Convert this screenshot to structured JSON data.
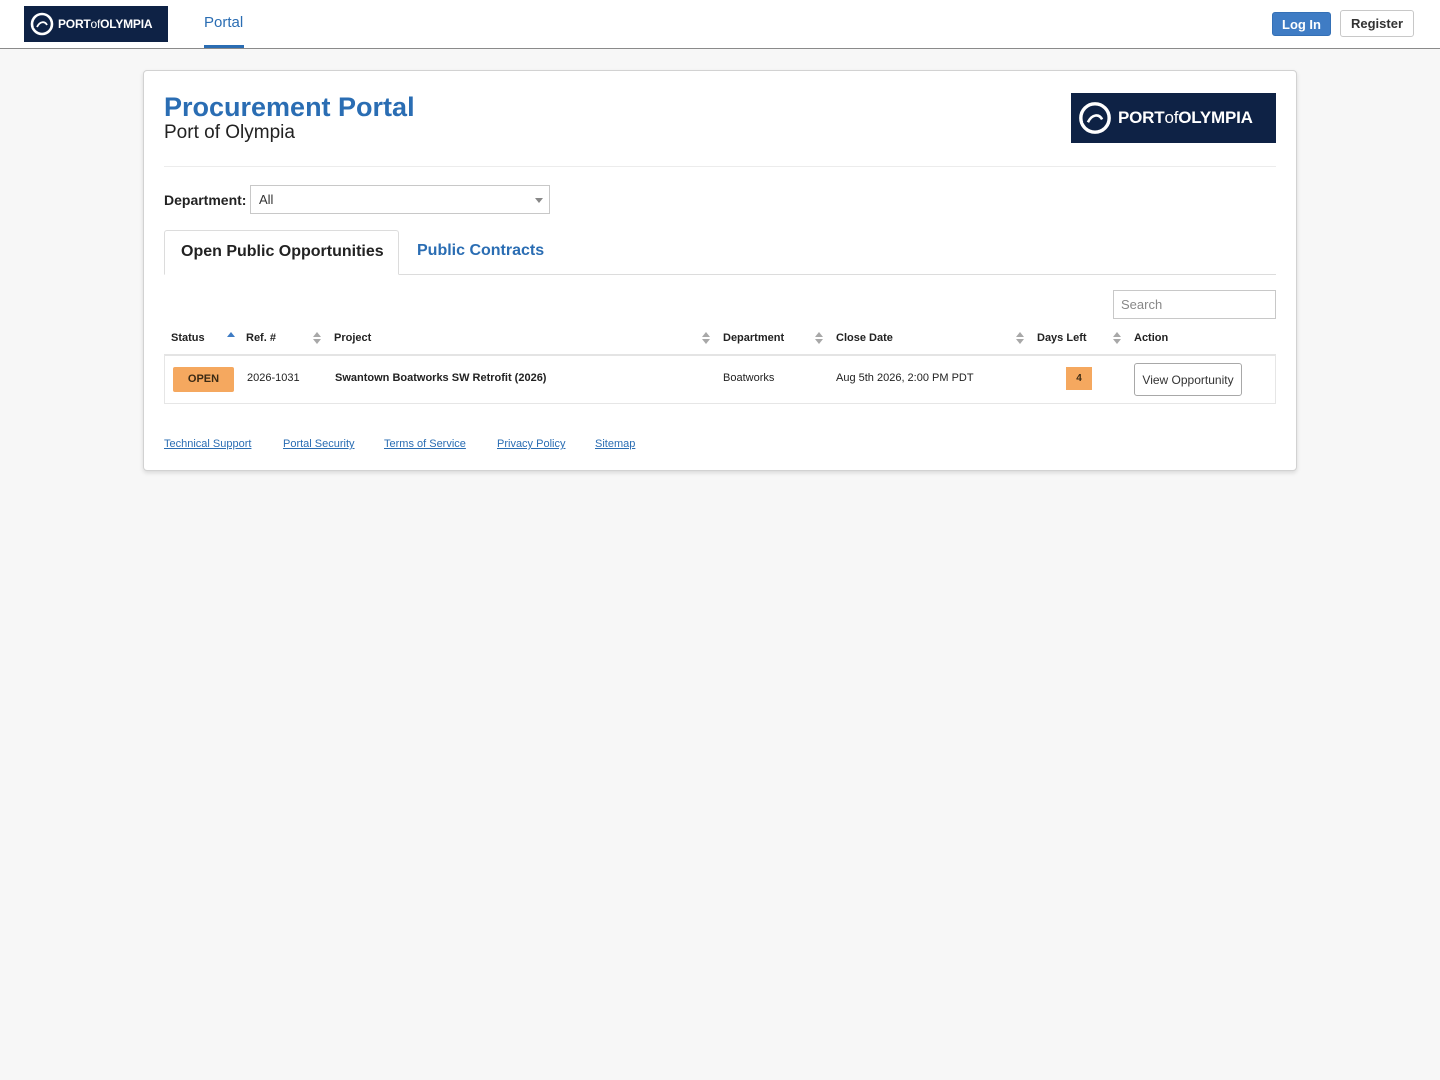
{
  "topnav": {
    "logo": {
      "port": "PORT",
      "of": "of",
      "olympia": "OLYMPIA"
    },
    "portal_link": "Portal",
    "login_label": "Log In",
    "register_label": "Register"
  },
  "header": {
    "title": "Procurement Portal",
    "subtitle": "Port of Olympia",
    "logo": {
      "port": "PORT",
      "of": "of",
      "olympia": "OLYMPIA"
    }
  },
  "filter": {
    "department_label": "Department:",
    "department_value": "All"
  },
  "tabs": [
    {
      "label": "Open Public Opportunities",
      "active": true
    },
    {
      "label": "Public Contracts",
      "active": false
    }
  ],
  "search": {
    "placeholder": "Search"
  },
  "table": {
    "columns": [
      "Status",
      "Ref. #",
      "Project",
      "Department",
      "Close Date",
      "Days Left",
      "Action"
    ],
    "rows": [
      {
        "status": "OPEN",
        "ref": "2026-1031",
        "project": "Swantown Boatworks SW Retrofit (2026)",
        "department": "Boatworks",
        "close_date": "Aug 5th 2026, 2:00 PM PDT",
        "days_left": "4",
        "action": "View Opportunity"
      }
    ]
  },
  "footer": {
    "links": [
      "Technical Support",
      "Portal Security",
      "Terms of Service",
      "Privacy Policy",
      "Sitemap"
    ]
  },
  "colors": {
    "brand_blue": "#2a6db3",
    "logo_navy": "#0e2245",
    "status_orange": "#f5a85f",
    "login_blue": "#3f7cc4"
  }
}
